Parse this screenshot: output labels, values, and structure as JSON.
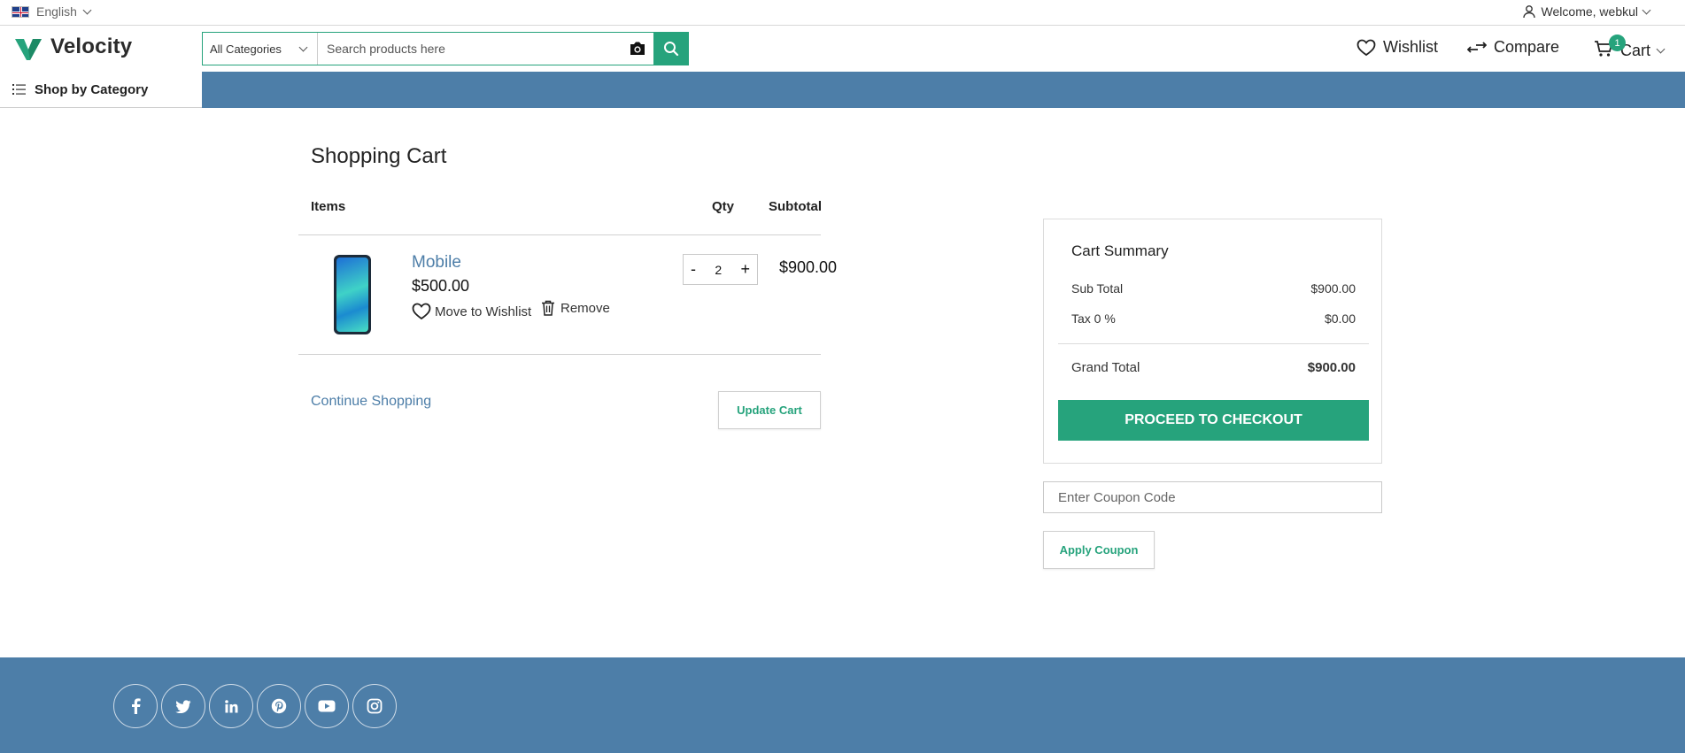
{
  "topbar": {
    "language": "English",
    "welcome": "Welcome, webkul"
  },
  "header": {
    "brand": "Velocity",
    "category_select": "All Categories",
    "search_placeholder": "Search products here",
    "wishlist": "Wishlist",
    "compare": "Compare",
    "cart": "Cart",
    "cart_count": "1"
  },
  "nav": {
    "shop_by_category": "Shop by Category"
  },
  "cart": {
    "title": "Shopping Cart",
    "headers": {
      "items": "Items",
      "qty": "Qty",
      "subtotal": "Subtotal"
    },
    "item": {
      "name": "Mobile",
      "price": "$500.00",
      "move_to_wishlist": "Move to Wishlist",
      "remove": "Remove",
      "qty": "2",
      "minus": "-",
      "plus": "+",
      "subtotal": "$900.00"
    },
    "continue_shopping": "Continue Shopping",
    "update_cart": "Update Cart"
  },
  "summary": {
    "title": "Cart Summary",
    "sub_total_label": "Sub Total",
    "sub_total_value": "$900.00",
    "tax_label": "Tax 0 %",
    "tax_value": "$0.00",
    "grand_total_label": "Grand Total",
    "grand_total_value": "$900.00",
    "checkout": "PROCEED TO CHECKOUT"
  },
  "coupon": {
    "placeholder": "Enter Coupon Code",
    "apply": "Apply Coupon"
  },
  "colors": {
    "accent": "#26a37c",
    "band": "#4d7ea8",
    "link": "#4d7ea8"
  },
  "footer": {
    "social": [
      "facebook-icon",
      "twitter-icon",
      "linkedin-icon",
      "pinterest-icon",
      "youtube-icon",
      "instagram-icon"
    ]
  }
}
